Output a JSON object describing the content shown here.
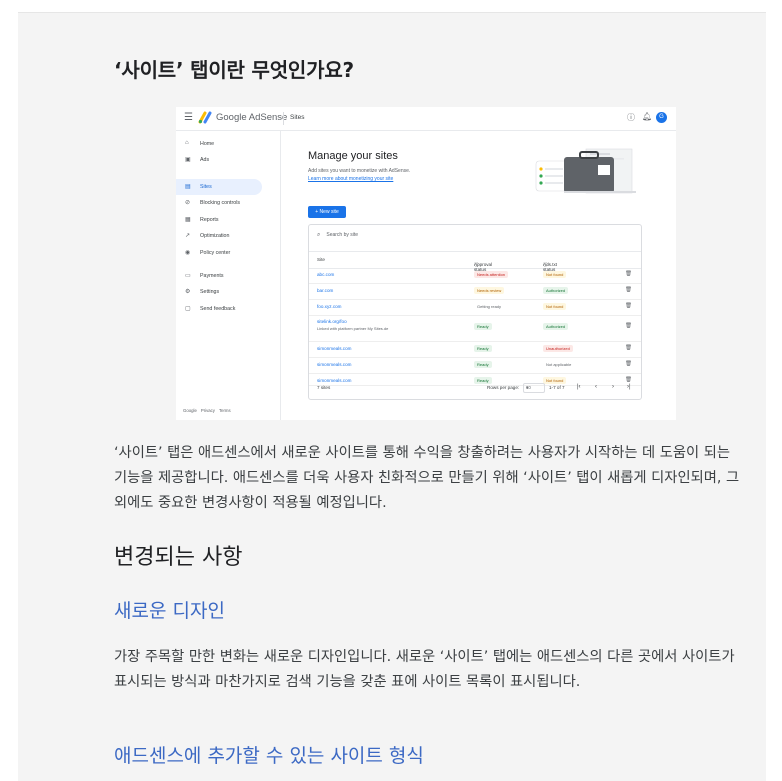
{
  "article": {
    "title": "‘사이트’ 탭이란 무엇인가요?",
    "para1": "‘사이트’ 탭은 애드센스에서 새로운 사이트를 통해 수익을 창출하려는 사용자가 시작하는 데 도움이 되는 기능을 제공합니다. 애드센스를 더욱 사용자 친화적으로 만들기 위해 ‘사이트’ 탭이 새롭게 디자인되며, 그 외에도 중요한 변경사항이 적용될 예정입니다.",
    "heading_changes": "변경되는 사항",
    "sub_design": "새로운 디자인",
    "para2": "가장 주목할 만한 변화는 새로운 디자인입니다. 새로운 ‘사이트’ 탭에는 애드센스의 다른 곳에서 사이트가 표시되는 방식과 마찬가지로 검색 기능을 갖춘 표에 사이트 목록이 표시됩니다.",
    "sub_formats": "애드센스에 추가할 수 있는 사이트 형식"
  },
  "screenshot": {
    "brand_google": "Google",
    "brand_adsense": "AdSense",
    "breadcrumb": "Sites",
    "avatar_letter": "G",
    "icons": [
      "menu-icon",
      "help-icon",
      "bell-icon",
      "avatar"
    ],
    "nav": [
      {
        "label": "Home",
        "icon": "home-icon"
      },
      {
        "label": "Ads",
        "icon": "ads-icon"
      },
      {
        "label": "Sites",
        "icon": "sites-icon",
        "active": true
      },
      {
        "label": "Blocking controls",
        "icon": "block-icon"
      },
      {
        "label": "Reports",
        "icon": "reports-icon"
      },
      {
        "label": "Optimization",
        "icon": "optimization-icon"
      },
      {
        "label": "Policy center",
        "icon": "policy-icon"
      },
      {
        "label": "Payments",
        "icon": "payments-icon"
      },
      {
        "label": "Settings",
        "icon": "settings-icon"
      },
      {
        "label": "Send feedback",
        "icon": "feedback-icon"
      }
    ],
    "footer": [
      "Google",
      "Privacy",
      "Terms"
    ],
    "heading": "Manage your sites",
    "subtitle": "Add sites you want to monetize with AdSense.",
    "learn_link": "Learn more about monetizing your site",
    "new_site": "+ New site",
    "search_placeholder": "Search by site",
    "columns": [
      "Site",
      "Approval status",
      "Ads.txt status"
    ],
    "rows": [
      {
        "site": "abc.com",
        "sub": "",
        "approval": "Needs attention",
        "ads_txt": "Not found"
      },
      {
        "site": "bar.com",
        "sub": "",
        "approval": "Needs review",
        "ads_txt": "Authorized"
      },
      {
        "site": "foo.xyz.com",
        "sub": "",
        "approval": "Getting ready",
        "ads_txt": "Not found"
      },
      {
        "site": "sitelink.org/foo",
        "sub": "Linked with platform partner My Sites.de",
        "approval": "Ready",
        "ads_txt": "Authorized"
      },
      {
        "site": "simonmeals.com",
        "sub": "",
        "approval": "Ready",
        "ads_txt": "Unauthorized"
      },
      {
        "site": "simonmeals.com",
        "sub": "",
        "approval": "Ready",
        "ads_txt": "Not applicable"
      },
      {
        "site": "simonmeals.com",
        "sub": "",
        "approval": "Ready",
        "ads_txt": "Not found"
      }
    ],
    "total": "7 sites",
    "rows_per_page_label": "Rows per page:",
    "rows_per_page_value": "10",
    "range": "1-7 of 7",
    "pager": [
      "|‹",
      "‹",
      "›",
      "›|"
    ],
    "chip_colors": {
      "Needs attention": [
        "#fce8e6",
        "#c5221f"
      ],
      "Needs review": [
        "#fef7e0",
        "#b06000"
      ],
      "Getting ready": [
        "#ffffff",
        "#5f6368"
      ],
      "Ready": [
        "#e6f4ea",
        "#137333"
      ],
      "Not found": [
        "#fef7e0",
        "#b06000"
      ],
      "Authorized": [
        "#e6f4ea",
        "#137333"
      ],
      "Unauthorized": [
        "#fce8e6",
        "#c5221f"
      ],
      "Not applicable": [
        "#ffffff",
        "#5f6368"
      ]
    },
    "accent": "#1a73e8"
  }
}
